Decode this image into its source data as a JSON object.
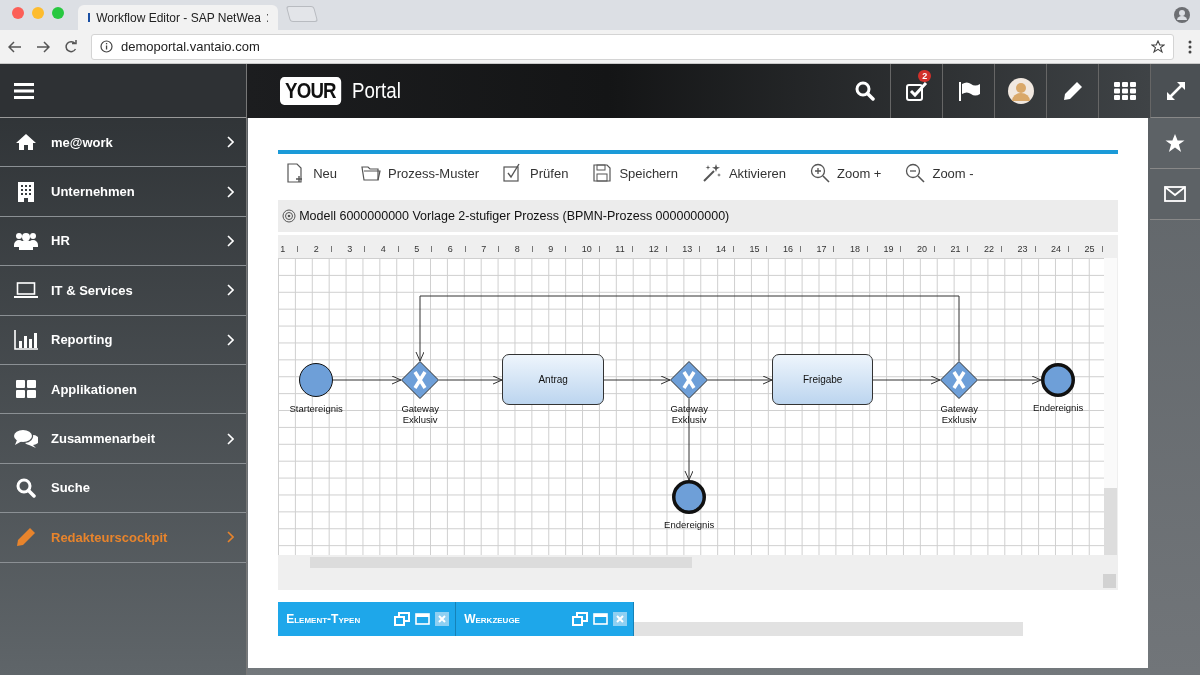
{
  "browser": {
    "tab_title": "Workflow Editor - SAP NetWea",
    "url": "demoportal.vantaio.com"
  },
  "sidebar": {
    "items": [
      {
        "label": "me@work",
        "expandable": true,
        "selected": false
      },
      {
        "label": "Unternehmen",
        "expandable": true,
        "selected": false
      },
      {
        "label": "HR",
        "expandable": true,
        "selected": false
      },
      {
        "label": "IT & Services",
        "expandable": true,
        "selected": false
      },
      {
        "label": "Reporting",
        "expandable": true,
        "selected": false
      },
      {
        "label": "Applikationen",
        "expandable": false,
        "selected": false
      },
      {
        "label": "Zusammenarbeit",
        "expandable": true,
        "selected": false
      },
      {
        "label": "Suche",
        "expandable": false,
        "selected": false
      },
      {
        "label": "Redakteurscockpit",
        "expandable": true,
        "selected": true
      }
    ]
  },
  "header": {
    "logo_box": "YOUR",
    "logo_text": "Portal",
    "task_badge": "2"
  },
  "toolbar": [
    {
      "label": "Neu"
    },
    {
      "label": "Prozess-Muster"
    },
    {
      "label": "Prüfen"
    },
    {
      "label": "Speichern"
    },
    {
      "label": "Aktivieren"
    },
    {
      "label": "Zoom +"
    },
    {
      "label": "Zoom -"
    }
  ],
  "model_title": "Modell 6000000000 Vorlage 2-stufiger Prozess (BPMN-Prozess 0000000000)",
  "ruler": [
    "1",
    "2",
    "3",
    "4",
    "5",
    "6",
    "7",
    "8",
    "9",
    "10",
    "11",
    "12",
    "13",
    "14",
    "15",
    "16",
    "17",
    "18",
    "19",
    "20",
    "21",
    "22",
    "23",
    "24",
    "25"
  ],
  "diagram": {
    "nodes": [
      {
        "kind": "start",
        "label": "Startereignis"
      },
      {
        "kind": "gateway",
        "label": "Gateway Exklusiv"
      },
      {
        "kind": "task",
        "label": "Antrag"
      },
      {
        "kind": "gateway",
        "label": "Gateway Exklusiv"
      },
      {
        "kind": "task",
        "label": "Freigabe"
      },
      {
        "kind": "gateway",
        "label": "Gateway Exklusiv"
      },
      {
        "kind": "end",
        "label": "Endereignis"
      },
      {
        "kind": "end",
        "label": "Endereignis"
      }
    ]
  },
  "panels": [
    {
      "title": "Element-Typen"
    },
    {
      "title": "Werkzeuge"
    }
  ]
}
